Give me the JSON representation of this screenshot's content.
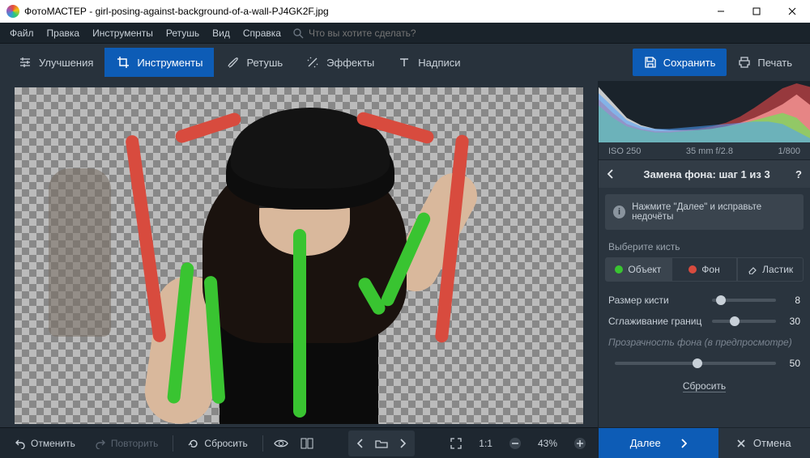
{
  "title": "ФотоМАСТЕР - girl-posing-against-background-of-a-wall-PJ4GK2F.jpg",
  "menu": {
    "file": "Файл",
    "edit": "Правка",
    "tools": "Инструменты",
    "retouch": "Ретушь",
    "view": "Вид",
    "help": "Справка",
    "search_placeholder": "Что вы хотите сделать?"
  },
  "tabs": {
    "enhance": "Улучшения",
    "tools": "Инструменты",
    "retouch": "Ретушь",
    "effects": "Эффекты",
    "text": "Надписи"
  },
  "actions": {
    "save": "Сохранить",
    "print": "Печать"
  },
  "bottom": {
    "undo": "Отменить",
    "redo": "Повторить",
    "reset": "Сбросить",
    "zoom_ratio": "1:1",
    "zoom_pct": "43%"
  },
  "meta": {
    "iso": "ISO 250",
    "lens": "35 mm f/2.8",
    "shutter": "1/800"
  },
  "panel": {
    "title": "Замена фона: шаг 1 из 3",
    "hint": "Нажмите \"Далее\" и исправьте недочёты",
    "choose_brush": "Выберите кисть",
    "brush_object": "Объект",
    "brush_bg": "Фон",
    "brush_eraser": "Ластик",
    "brush_size": "Размер кисти",
    "brush_size_val": "8",
    "smooth": "Сглаживание границ",
    "smooth_val": "30",
    "opacity_label": "Прозрачность фона",
    "opacity_hint": "(в предпросмотре)",
    "opacity_val": "50",
    "reset": "Сбросить",
    "next": "Далее",
    "cancel": "Отмена"
  },
  "chart_data": {
    "type": "area",
    "title": "Histogram",
    "bins": 16,
    "series": [
      {
        "name": "luma",
        "color": "#e8e8e8",
        "values": [
          90,
          65,
          40,
          28,
          22,
          20,
          20,
          20,
          22,
          26,
          32,
          40,
          50,
          62,
          78,
          60
        ]
      },
      {
        "name": "red",
        "color": "#ff4d4d",
        "values": [
          70,
          48,
          30,
          22,
          18,
          18,
          20,
          22,
          26,
          32,
          42,
          56,
          72,
          88,
          96,
          90
        ]
      },
      {
        "name": "green",
        "color": "#4dff4d",
        "values": [
          60,
          40,
          26,
          20,
          16,
          16,
          18,
          20,
          22,
          26,
          30,
          36,
          42,
          48,
          40,
          18
        ]
      },
      {
        "name": "blue",
        "color": "#4da0ff",
        "values": [
          80,
          58,
          36,
          26,
          22,
          22,
          24,
          26,
          28,
          30,
          32,
          34,
          34,
          30,
          18,
          6
        ]
      }
    ],
    "xlim": [
      0,
      255
    ],
    "ylim": [
      0,
      100
    ]
  }
}
